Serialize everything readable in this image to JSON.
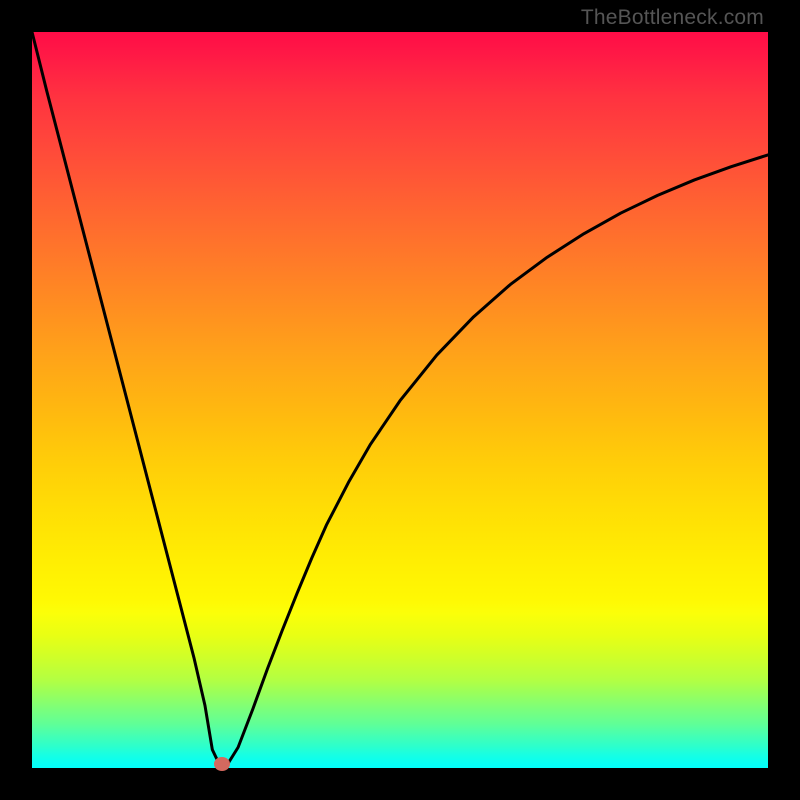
{
  "watermark": "TheBottleneck.com",
  "colors": {
    "frame": "#000000",
    "marker": "#d4695f",
    "curve": "#000000"
  },
  "gradient_css": "linear-gradient(to bottom, #ff0c47 0%, #ff1d45 4%, #ff3340 9%, #ff4a3a 16%, #ff6132 23%, #ff772a 30%, #ff8d21 37%, #ffa319 44%, #ffb710 51%, #ffcc09 58%, #ffde05 65%, #ffec03 71%, #fff803 77%, #fbff09 79%, #e8ff14 82%, #cfff29 85%, #b3ff42 88%, #97ff5e 90%, #7bff7b 92%, #60ff97 94%, #46ffb2 95.5%, #2dffcb 97%, #1bffdf 98%, #0cffef 99%, #03fefb 100%)",
  "chart_data": {
    "type": "line",
    "title": "",
    "xlabel": "",
    "ylabel": "",
    "xlim": [
      0,
      100
    ],
    "ylim": [
      0,
      100
    ],
    "series": [
      {
        "name": "bottleneck-curve",
        "x": [
          0,
          2,
          4,
          6,
          8,
          10,
          12,
          14,
          16,
          18,
          20,
          22,
          23.5,
          24.5,
          25.5,
          26.5,
          28,
          30,
          32,
          34,
          36,
          38,
          40,
          43,
          46,
          50,
          55,
          60,
          65,
          70,
          75,
          80,
          85,
          90,
          95,
          100
        ],
        "y": [
          100,
          92,
          84.3,
          76.6,
          68.9,
          61.2,
          53.5,
          45.8,
          38.1,
          30.4,
          22.7,
          15,
          8.5,
          2.5,
          0.4,
          0.4,
          2.8,
          8,
          13.5,
          18.7,
          23.7,
          28.5,
          33,
          38.8,
          44,
          49.9,
          56.1,
          61.3,
          65.7,
          69.4,
          72.6,
          75.4,
          77.8,
          79.9,
          81.7,
          83.3
        ]
      }
    ],
    "marker": {
      "x": 25.8,
      "y": 0.6
    },
    "annotations": []
  }
}
